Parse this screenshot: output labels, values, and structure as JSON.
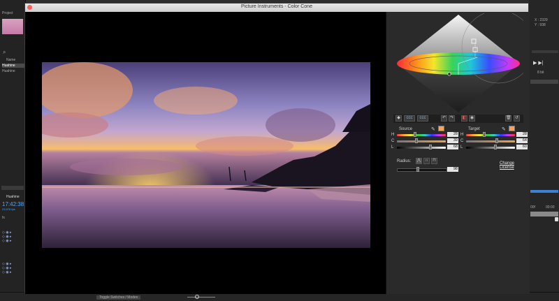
{
  "host": {
    "project_tab": "Project",
    "search_glyph": "⌕",
    "list_header": "Name",
    "items": [
      "Huahine",
      "Huahine"
    ],
    "timeline_tab": "Huahine",
    "timecode": "17:42:38:",
    "timecode_sub": "23,976 fps",
    "coords_x": "X : 2329",
    "coords_y": "Y : 938",
    "pixel_label": "8 bit",
    "time_marks": [
      "00f",
      "00:00"
    ],
    "bottom_toggle": "Toggle Switches / Modes"
  },
  "window": {
    "title": "Picture Instruments - Color Cone",
    "close_color": "#fc605c",
    "minimize_color": "#fdbc40",
    "zoom_color": "#34c84a"
  },
  "panel": {
    "source": {
      "label": "Source",
      "swatch": "#f0a85a",
      "h": 28,
      "c": 39,
      "l": 68
    },
    "target": {
      "label": "Target",
      "swatch": "#f4a35e",
      "h": 28,
      "c": 64,
      "l": 60
    },
    "radius": {
      "label": "Radius:",
      "value": 98
    },
    "channel_labels": [
      "H",
      "C",
      "L"
    ],
    "change_license": "Change License",
    "toolbar": [
      "◆",
      "ccc",
      "ccc",
      "↶",
      "↷",
      "◧",
      "◉",
      "🗑",
      "↺"
    ]
  }
}
